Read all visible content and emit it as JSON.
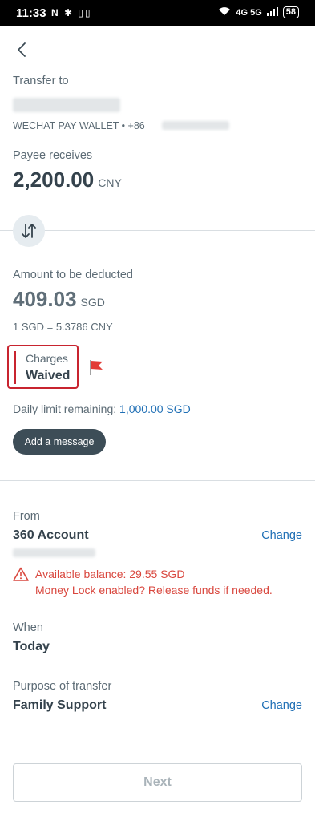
{
  "status_bar": {
    "time": "11:33",
    "icons": "N ✱ ▯▯",
    "network": "4G 5G",
    "battery": "58"
  },
  "header": {
    "transfer_to_label": "Transfer to",
    "recipient_sub": "WECHAT PAY WALLET • +86"
  },
  "payee": {
    "label": "Payee receives",
    "amount": "2,200.00",
    "currency": "CNY"
  },
  "deduction": {
    "label": "Amount to be deducted",
    "amount": "409.03",
    "currency": "SGD",
    "rate": "1 SGD = 5.3786 CNY"
  },
  "charges": {
    "label": "Charges",
    "value": "Waived"
  },
  "limit": {
    "label": "Daily limit remaining:",
    "value": "1,000.00 SGD"
  },
  "add_message_label": "Add a message",
  "from": {
    "label": "From",
    "account": "360 Account",
    "change_label": "Change",
    "warning_line1": "Available balance: 29.55 SGD",
    "warning_line2": "Money Lock enabled? Release funds if needed."
  },
  "when": {
    "label": "When",
    "value": "Today"
  },
  "purpose": {
    "label": "Purpose of transfer",
    "value": "Family Support",
    "change_label": "Change"
  },
  "next_label": "Next",
  "colors": {
    "accent_link": "#1f6fb5",
    "warning": "#d9473e",
    "highlight_border": "#c8242f",
    "dark_button": "#3d4d57"
  },
  "icons": {
    "back": "back-arrow-icon",
    "swap": "swap-arrows-icon",
    "flag": "flag-icon",
    "warning": "warning-triangle-icon"
  }
}
